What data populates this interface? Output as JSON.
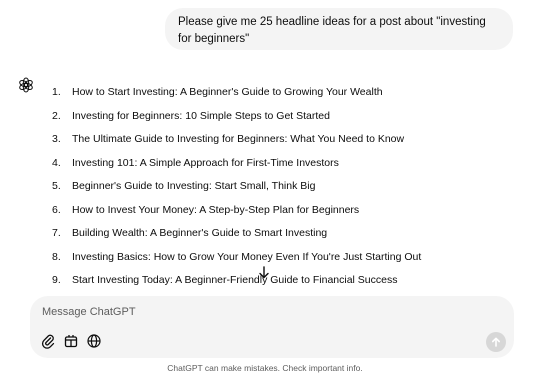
{
  "conversation": {
    "user_message": "Please give me 25 headline ideas for a post about \"investing for beginners\"",
    "assistant_icon": "chatgpt-logo-icon",
    "headlines": [
      {
        "num": "1.",
        "text": "How to Start Investing: A Beginner's Guide to Growing Your Wealth"
      },
      {
        "num": "2.",
        "text": "Investing for Beginners: 10 Simple Steps to Get Started"
      },
      {
        "num": "3.",
        "text": "The Ultimate Guide to Investing for Beginners: What You Need to Know"
      },
      {
        "num": "4.",
        "text": "Investing 101: A Simple Approach for First-Time Investors"
      },
      {
        "num": "5.",
        "text": "Beginner's Guide to Investing: Start Small, Think Big"
      },
      {
        "num": "6.",
        "text": "How to Invest Your Money: A Step-by-Step Plan for Beginners"
      },
      {
        "num": "7.",
        "text": "Building Wealth: A Beginner's Guide to Smart Investing"
      },
      {
        "num": "8.",
        "text": "Investing Basics: How to Grow Your Money Even If You're Just Starting Out"
      },
      {
        "num": "9.",
        "text": "Start Investing Today: A Beginner-Friendly Guide to Financial Success"
      }
    ],
    "scroll_icon": "arrow-down-icon"
  },
  "composer": {
    "placeholder": "Message ChatGPT",
    "tools": [
      "paperclip-icon",
      "tools-grid-icon",
      "globe-icon"
    ],
    "send_icon": "arrow-up-icon"
  },
  "footer": {
    "note": "ChatGPT can make mistakes. Check important info."
  },
  "colors": {
    "bubble_bg": "#f4f4f4",
    "text": "#0d0d0d",
    "muted": "#5d5d5d",
    "send_disabled": "#d7d7d7"
  }
}
